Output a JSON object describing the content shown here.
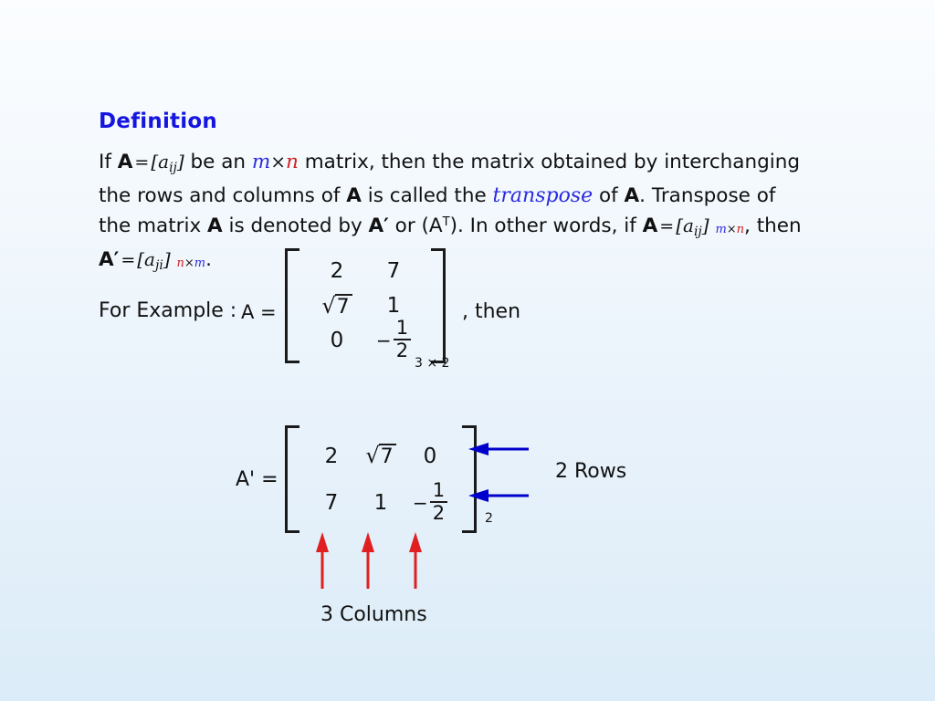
{
  "slide": {
    "heading": "Definition",
    "definition": {
      "seg1": "If ",
      "A1": "A",
      "eq1": "=",
      "br_open": "[",
      "a1": "a",
      "ij1": "ij",
      "br_close": "]",
      "seg2": " be an ",
      "m1": "m",
      "times1": "×",
      "n1": "n",
      "seg3": " matrix, then the matrix obtained by interchanging the rows and columns of ",
      "A2": "A",
      "seg4": " is called the ",
      "transpose": "transpose",
      "seg5": " of ",
      "A3": "A",
      "seg6": ". Transpose of the matrix ",
      "A4": "A",
      "seg7": " is denoted by ",
      "Aprime1": "A′",
      "seg8": " or (A",
      "supT": "T",
      "seg9": "). In other words, if ",
      "A5": "A",
      "eq2": "=",
      "a2": "a",
      "ij2": "ij",
      "sub_m1": "m",
      "sub_times1": "×",
      "sub_n1": "n",
      "seg10": ", then ",
      "Aprime2": "A′",
      "eq3": "=",
      "a3": "a",
      "ji": "ji",
      "sub_n2": "n",
      "sub_times2": "×",
      "sub_m2": "m",
      "period": "."
    },
    "example": {
      "label": "For Example :",
      "matrixA_label": "A =",
      "then_label": ", then",
      "matrixAT_label": "A' ="
    },
    "matrixA": {
      "rows": [
        [
          "2",
          "7"
        ],
        [
          "√7",
          "1"
        ],
        [
          "0",
          "−1/2"
        ]
      ],
      "cells": {
        "r0c0": "2",
        "r0c1": "7",
        "r1c0_radicand": "7",
        "r1c1": "1",
        "r2c0": "0",
        "r2c1_num": "1",
        "r2c1_den": "2",
        "r2c1_sign": "−"
      },
      "dimension": "3 × 2",
      "dim_rows": "3",
      "dim_times": "×",
      "dim_cols": "2"
    },
    "matrixAT": {
      "rows": [
        [
          "2",
          "√7",
          "0"
        ],
        [
          "7",
          "1",
          "−1/2"
        ]
      ],
      "cells": {
        "r0c0": "2",
        "r0c1_radicand": "7",
        "r0c2": "0",
        "r1c0": "7",
        "r1c1": "1",
        "r1c2_num": "1",
        "r1c2_den": "2",
        "r1c2_sign": "−"
      },
      "dimension": "2"
    },
    "annotations": {
      "rows_label": "2 Rows",
      "columns_label": "3 Columns"
    },
    "radical_sign": "√"
  },
  "colors": {
    "heading_blue": "#1515e0",
    "accent_blue": "#2a2ae0",
    "accent_red": "#d02020",
    "arrow_blue": "#0000cc",
    "arrow_red": "#e02020",
    "text": "#111111",
    "bg_top": "#fbfdff",
    "bg_bottom": "#dbecf8"
  }
}
